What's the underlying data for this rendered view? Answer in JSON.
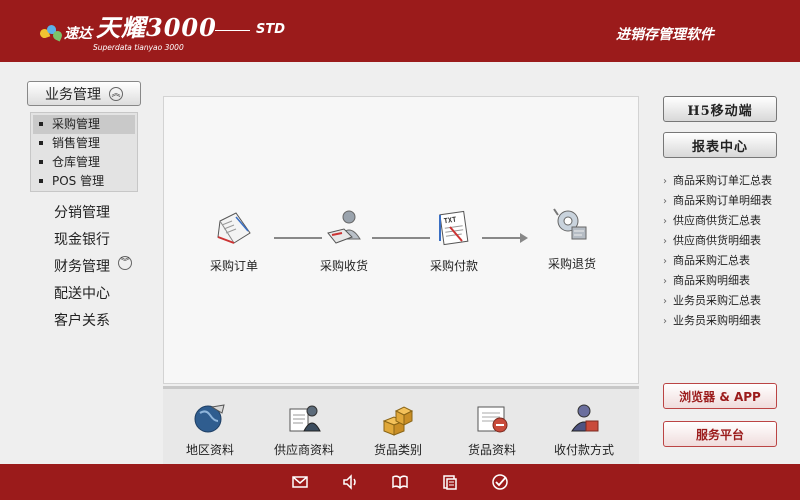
{
  "header": {
    "brand": "速达",
    "product": "天耀3000",
    "edition": "STD",
    "subtitle": "Superdata tianyao 3000",
    "app_title": "进销存管理软件"
  },
  "sidebar": {
    "head_label": "业务管理",
    "submenu": [
      {
        "label": "采购管理",
        "active": true
      },
      {
        "label": "销售管理",
        "active": false
      },
      {
        "label": "仓库管理",
        "active": false
      },
      {
        "label": "POS 管理",
        "active": false
      }
    ],
    "items": [
      "分销管理",
      "现金银行",
      "财务管理",
      "配送中心",
      "客户关系"
    ]
  },
  "flow": {
    "steps": [
      {
        "label": "采购订单",
        "icon": "notebook-icon"
      },
      {
        "label": "采购收货",
        "icon": "receiving-person-icon"
      },
      {
        "label": "采购付款",
        "icon": "txt-document-icon"
      },
      {
        "label": "采购退货",
        "icon": "return-gear-icon"
      }
    ]
  },
  "bottom": {
    "items": [
      {
        "label": "地区资料",
        "icon": "globe-icon"
      },
      {
        "label": "供应商资料",
        "icon": "supplier-person-icon"
      },
      {
        "label": "货品类别",
        "icon": "boxes-icon"
      },
      {
        "label": "货品资料",
        "icon": "goods-document-icon"
      },
      {
        "label": "收付款方式",
        "icon": "payment-icon"
      }
    ]
  },
  "right": {
    "mobile_button": "H5移动端",
    "report_button": "报表中心",
    "reports": [
      "商品采购订单汇总表",
      "商品采购订单明细表",
      "供应商供货汇总表",
      "供应商供货明细表",
      "商品采购汇总表",
      "商品采购明细表",
      "业务员采购汇总表",
      "业务员采购明细表"
    ],
    "browser_button": "浏览器 & APP",
    "service_button": "服务平台"
  },
  "footer": {
    "icons": [
      "mail-icon",
      "speaker-icon",
      "book-icon",
      "documents-icon",
      "check-icon"
    ]
  },
  "colors": {
    "header_bg": "#9b1b1b",
    "accent_red": "#9b1b1b"
  }
}
